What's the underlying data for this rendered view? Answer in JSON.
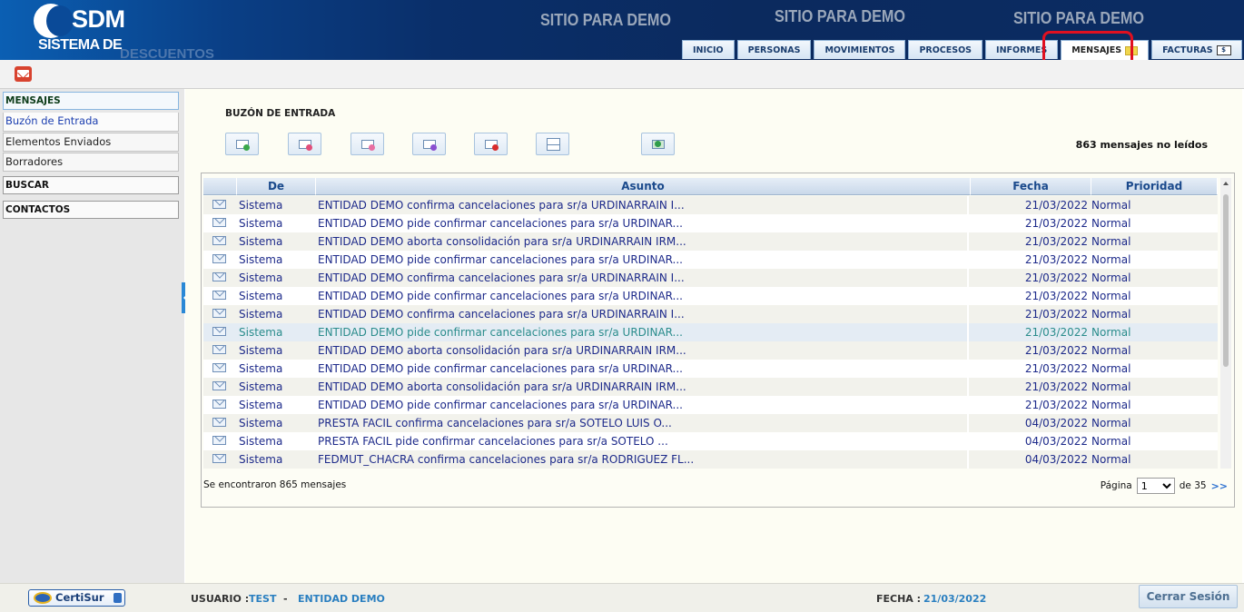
{
  "header": {
    "logo_title": "SDM",
    "logo_subtitle": "SISTEMA DE",
    "logo_subtitle2": "DESCUENTOS",
    "demo_banners": [
      "SITIO PARA DEMO",
      "SITIO PARA DEMO",
      "SITIO PARA DEMO"
    ],
    "tabs": [
      {
        "label": "INICIO"
      },
      {
        "label": "PERSONAS"
      },
      {
        "label": "MOVIMIENTOS"
      },
      {
        "label": "PROCESOS"
      },
      {
        "label": "INFORMES"
      },
      {
        "label": "MENSAJES",
        "active": true,
        "icon": "envelope-icon"
      },
      {
        "label": "FACTURAS",
        "icon": "invoice-icon"
      }
    ]
  },
  "sidebar": {
    "section_mensajes": "MENSAJES",
    "items": [
      {
        "label": "Buzón de Entrada"
      },
      {
        "label": "Elementos Enviados"
      },
      {
        "label": "Borradores"
      }
    ],
    "section_buscar": "BUSCAR",
    "section_contactos": "CONTACTOS"
  },
  "main": {
    "title": "BUZÓN DE ENTRADA",
    "unread": "863 mensajes no leídos",
    "toolbar_icons": [
      "new-message-icon",
      "reply-icon",
      "reply-all-icon",
      "forward-icon",
      "delete-message-icon",
      "split-view-icon",
      "refresh-inbox-icon"
    ],
    "columns": [
      "De",
      "Asunto",
      "Fecha",
      "Prioridad"
    ],
    "rows": [
      {
        "de": "Sistema",
        "asunto": "ENTIDAD DEMO confirma cancelaciones para sr/a URDINARRAIN I...",
        "fecha": "21/03/2022",
        "prioridad": "Normal"
      },
      {
        "de": "Sistema",
        "asunto": "ENTIDAD DEMO pide confirmar cancelaciones para sr/a URDINAR...",
        "fecha": "21/03/2022",
        "prioridad": "Normal"
      },
      {
        "de": "Sistema",
        "asunto": "ENTIDAD DEMO aborta consolidación para sr/a URDINARRAIN IRM...",
        "fecha": "21/03/2022",
        "prioridad": "Normal"
      },
      {
        "de": "Sistema",
        "asunto": "ENTIDAD DEMO pide confirmar cancelaciones para sr/a URDINAR...",
        "fecha": "21/03/2022",
        "prioridad": "Normal"
      },
      {
        "de": "Sistema",
        "asunto": "ENTIDAD DEMO confirma cancelaciones para sr/a URDINARRAIN I...",
        "fecha": "21/03/2022",
        "prioridad": "Normal"
      },
      {
        "de": "Sistema",
        "asunto": "ENTIDAD DEMO pide confirmar cancelaciones para sr/a URDINAR...",
        "fecha": "21/03/2022",
        "prioridad": "Normal"
      },
      {
        "de": "Sistema",
        "asunto": "ENTIDAD DEMO confirma cancelaciones para sr/a URDINARRAIN I...",
        "fecha": "21/03/2022",
        "prioridad": "Normal"
      },
      {
        "de": "Sistema",
        "asunto": "ENTIDAD DEMO pide confirmar cancelaciones para sr/a URDINAR...",
        "fecha": "21/03/2022",
        "prioridad": "Normal",
        "highlighted": true
      },
      {
        "de": "Sistema",
        "asunto": "ENTIDAD DEMO aborta consolidación para sr/a URDINARRAIN IRM...",
        "fecha": "21/03/2022",
        "prioridad": "Normal"
      },
      {
        "de": "Sistema",
        "asunto": "ENTIDAD DEMO pide confirmar cancelaciones para sr/a URDINAR...",
        "fecha": "21/03/2022",
        "prioridad": "Normal"
      },
      {
        "de": "Sistema",
        "asunto": "ENTIDAD DEMO aborta consolidación para sr/a URDINARRAIN IRM...",
        "fecha": "21/03/2022",
        "prioridad": "Normal"
      },
      {
        "de": "Sistema",
        "asunto": "ENTIDAD DEMO pide confirmar cancelaciones para sr/a URDINAR...",
        "fecha": "21/03/2022",
        "prioridad": "Normal"
      },
      {
        "de": "Sistema",
        "asunto": "PRESTA FACIL confirma cancelaciones para sr/a SOTELO LUIS O...",
        "fecha": "04/03/2022",
        "prioridad": "Normal"
      },
      {
        "de": "Sistema",
        "asunto": "PRESTA FACIL pide confirmar cancelaciones para sr/a SOTELO ...",
        "fecha": "04/03/2022",
        "prioridad": "Normal"
      },
      {
        "de": "Sistema",
        "asunto": "FEDMUT_CHACRA confirma cancelaciones para sr/a RODRIGUEZ FL...",
        "fecha": "04/03/2022",
        "prioridad": "Normal"
      }
    ],
    "found_text": "Se encontraron 865 mensajes",
    "pager": {
      "label": "Página",
      "current": "1",
      "of_label": "de 35",
      "next": ">>"
    }
  },
  "footer": {
    "certisur": "CertiSur",
    "usuario_label": "USUARIO :",
    "usuario": "TEST",
    "separator": "-",
    "entidad": "ENTIDAD DEMO",
    "fecha_label": "FECHA :",
    "fecha": "21/03/2022",
    "logout": "Cerrar Sesión"
  }
}
